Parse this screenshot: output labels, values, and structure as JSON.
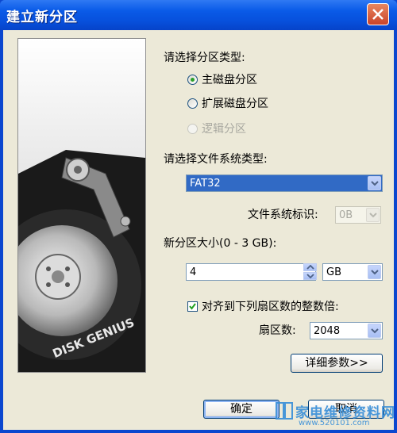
{
  "window": {
    "title": "建立新分区"
  },
  "partition_type": {
    "label": "请选择分区类型:",
    "options": [
      {
        "label": "主磁盘分区",
        "selected": true,
        "enabled": true
      },
      {
        "label": "扩展磁盘分区",
        "selected": false,
        "enabled": true
      },
      {
        "label": "逻辑分区",
        "selected": false,
        "enabled": false
      }
    ]
  },
  "filesystem": {
    "label": "请选择文件系统类型:",
    "value": "FAT32",
    "id_label": "文件系统标识:",
    "id_value": "0B"
  },
  "size": {
    "label": "新分区大小(0 - 3 GB):",
    "value": "4",
    "unit": "GB"
  },
  "align": {
    "label": "对齐到下列扇区数的整数倍:",
    "checked": true,
    "sectors_label": "扇区数:",
    "sectors_value": "2048"
  },
  "buttons": {
    "details": "详细参数>>",
    "ok": "确定",
    "cancel": "取消"
  },
  "sidebar": {
    "brand": "DISK GENIUS"
  },
  "watermark": {
    "text": "家电维修资料网",
    "url": "www.520101.com"
  },
  "colors": {
    "title_bar": "#0a5be8",
    "selection": "#316ac5",
    "dialog_bg": "#ece9d8"
  }
}
